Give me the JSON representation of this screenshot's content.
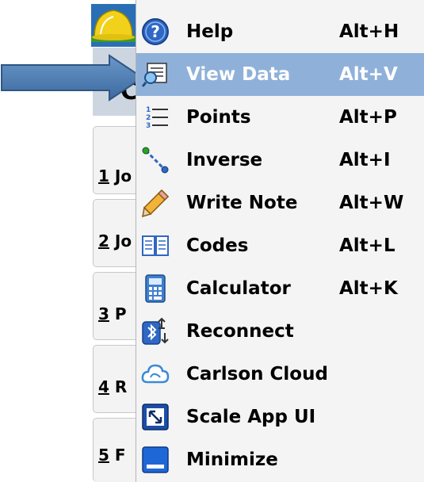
{
  "background": {
    "header_char": "C",
    "buttons": [
      {
        "num": "1",
        "text": "Jo"
      },
      {
        "num": "2",
        "text": "Jo"
      },
      {
        "num": "3",
        "text": "P"
      },
      {
        "num": "4",
        "text": "R"
      },
      {
        "num": "5",
        "text": "F"
      }
    ]
  },
  "menu": {
    "items": [
      {
        "label": "Help",
        "shortcut": "Alt+H",
        "icon": "help-icon"
      },
      {
        "label": "View Data",
        "shortcut": "Alt+V",
        "icon": "view-data-icon",
        "active": true
      },
      {
        "label": "Points",
        "shortcut": "Alt+P",
        "icon": "points-list-icon"
      },
      {
        "label": "Inverse",
        "shortcut": "Alt+I",
        "icon": "inverse-icon"
      },
      {
        "label": "Write Note",
        "shortcut": "Alt+W",
        "icon": "pencil-icon"
      },
      {
        "label": "Codes",
        "shortcut": "Alt+L",
        "icon": "book-icon"
      },
      {
        "label": "Calculator",
        "shortcut": "Alt+K",
        "icon": "calculator-icon"
      },
      {
        "label": "Reconnect",
        "shortcut": "",
        "icon": "bluetooth-reconnect-icon"
      },
      {
        "label": "Carlson Cloud",
        "shortcut": "",
        "icon": "cloud-icon"
      },
      {
        "label": "Scale App UI",
        "shortcut": "",
        "icon": "scale-icon"
      },
      {
        "label": "Minimize",
        "shortcut": "",
        "icon": "minimize-icon"
      }
    ]
  },
  "colors": {
    "highlight": "#8fb1d9",
    "arrow": "#4a77aa"
  }
}
